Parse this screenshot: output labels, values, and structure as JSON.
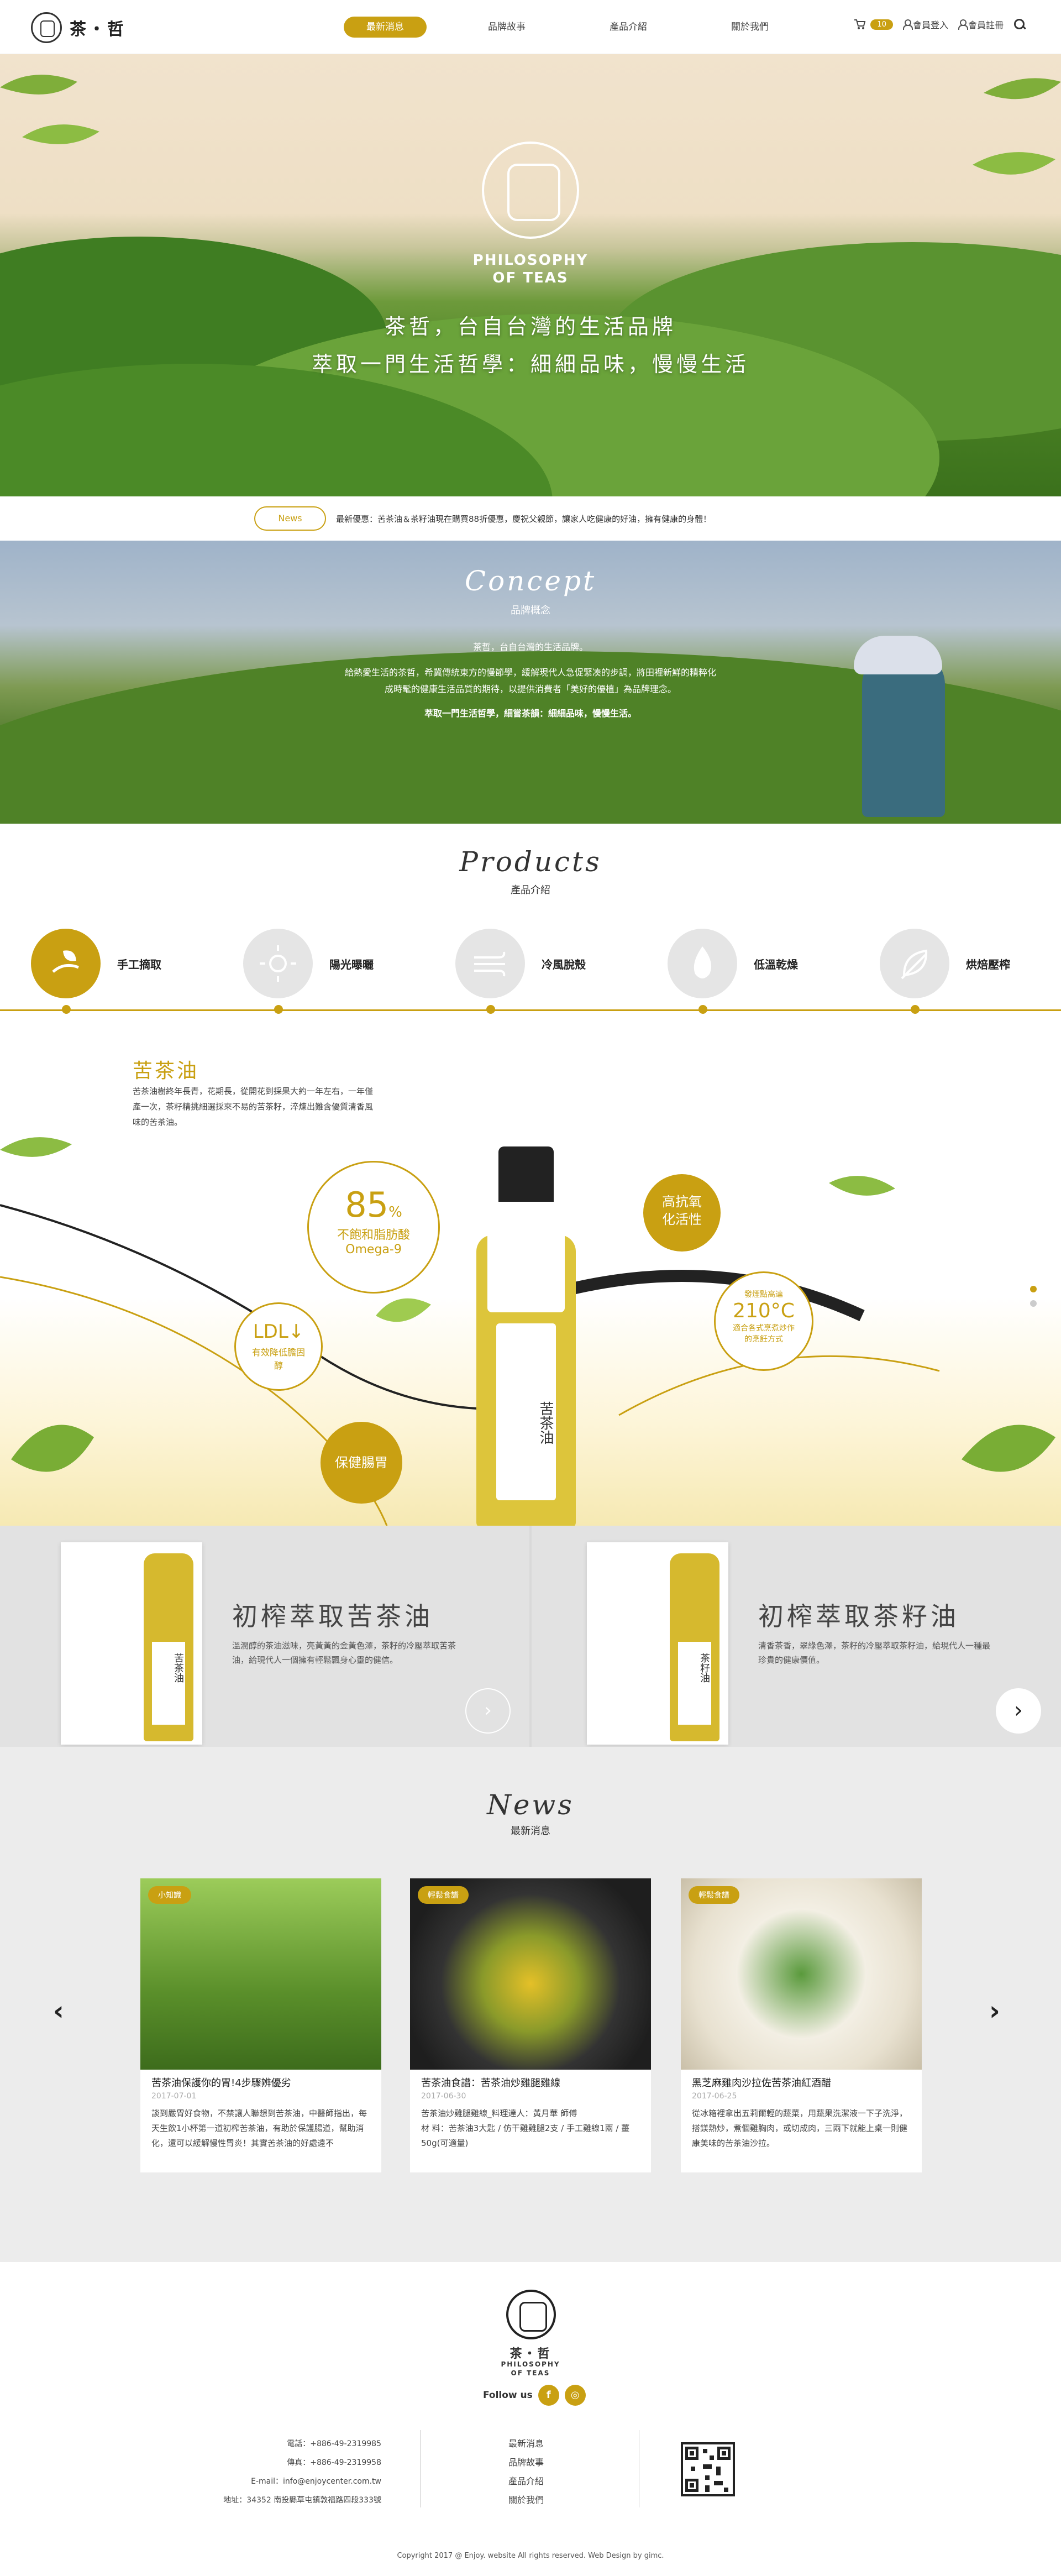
{
  "header": {
    "brand": "茶・哲",
    "nav": [
      {
        "label": "最新消息",
        "active": true
      },
      {
        "label": "品牌故事",
        "active": false
      },
      {
        "label": "產品介紹",
        "active": false
      },
      {
        "label": "關於我們",
        "active": false
      }
    ],
    "cart_count": "10",
    "login": "會員登入",
    "register": "會員註冊",
    "icons": [
      "cart-icon",
      "user-icon",
      "add-user-icon",
      "search-icon"
    ]
  },
  "hero": {
    "logo_en": "PHILOSOPHY",
    "logo_en2": "OF TEAS",
    "line1": "茶哲，台自台灣的生活品牌",
    "line2": "萃取一門生活哲學：細細品味，慢慢生活"
  },
  "newsbar": {
    "pill": "News",
    "text": "最新優惠：苦茶油＆茶籽油現在購買88折優惠，慶祝父親節，讓家人吃健康的好油，擁有健康的身體！"
  },
  "concept": {
    "title": "Concept",
    "subtitle": "品牌概念",
    "p1": "茶哲，台自台灣的生活品牌。",
    "p2": "給熱愛生活的茶哲，希冀傳統東方的慢節學，緩解現代人急促緊凑的步調，將田裡新鮮的精粹化",
    "p3": "成時髦的健康生活品質的期待，以提供消費者「美好的優植」為品牌理念。",
    "p4": "萃取一門生活哲學，細嘗茶韻：細細品味，慢慢生活。"
  },
  "products": {
    "title": "Products",
    "subtitle": "產品介紹",
    "steps": [
      {
        "label": "手工摘取",
        "icon": "hand-leaf-icon",
        "active": true
      },
      {
        "label": "陽光曝曬",
        "icon": "sun-icon",
        "active": false
      },
      {
        "label": "冷風脫殼",
        "icon": "wind-icon",
        "active": false
      },
      {
        "label": "低溫乾燥",
        "icon": "flame-icon",
        "active": false
      },
      {
        "label": "烘焙壓榨",
        "icon": "leaf-slash-icon",
        "active": false
      }
    ],
    "oil_title": "苦茶油",
    "oil_desc": "苦茶油樹終年長青，花期長，從開花到採果大約一年左右，一年僅產一次，茶籽精挑細選採來不易的苦茶籽，淬煉出難含優質清香風味的苦茶油。",
    "bottle_label": "苦茶油",
    "bubbles": {
      "omega_value": "85",
      "omega_unit": "%",
      "omega_line1": "不飽和脂肪酸",
      "omega_line2": "Omega-9",
      "antiox": "高抗氧化活性",
      "ldl": "LDL↓",
      "ldl_sub": "有效降低膽固醇",
      "smoke_top": "發煙點高達",
      "smoke_val": "210°C",
      "smoke_sub": "適合各式烹煮炒作的烹飪方式",
      "stomach": "保健腸胃"
    }
  },
  "cards": [
    {
      "title": "初榨萃取苦茶油",
      "desc": "溫潤醇的茶油滋味，亮黃黃的金黃色澤，茶籽的冷壓萃取苦茶油，給現代人一個擁有輕鬆飄身心靈的健信。",
      "bottle": "苦茶油"
    },
    {
      "title": "初榨萃取茶籽油",
      "desc": "清香茶香，翠綠色澤，茶籽的冷壓萃取茶籽油，給現代人一種最珍貴的健康價值。",
      "bottle": "茶籽油"
    }
  ],
  "news": {
    "title": "News",
    "subtitle": "最新消息",
    "items": [
      {
        "tag": "小知識",
        "title": "苦茶油保護你的胃!4步驟辨優劣",
        "date": "2017-07-01",
        "text": "談到嚴胃好食物，不禁讓人聯想到苦茶油，中醫師指出，每天生飲1小杯第一道初榨苦茶油，有助於保護腸道，幫助消化，還可以緩解慢性胃炎！其實苦茶油的好處遠不"
      },
      {
        "tag": "輕鬆食譜",
        "title": "苦茶油食譜：苦茶油炒雞腿雞線",
        "date": "2017-06-30",
        "text": "苦茶油炒雞腿雞線_料理達人：黃月華 師傅\n材 料：苦茶油3大匙 / 仿干雞雞腿2支 / 手工雞線1兩 / 薑50g(可適量)"
      },
      {
        "tag": "輕鬆食譜",
        "title": "黑芝麻雞肉沙拉佐苦茶油紅酒醋",
        "date": "2017-06-25",
        "text": "從冰箱裡拿出五莉爾輕的蔬菜，用蔬果洗潔液一下子洗淨，搭鎂熱炒，煮個雞胸肉，或切成肉，三兩下就能上桌一則健康美味的苦茶油沙拉。"
      }
    ]
  },
  "footer": {
    "brand": "茶・哲",
    "en1": "PHILOSOPHY",
    "en2": "OF TEAS",
    "follow": "Follow us",
    "social": [
      "f",
      "◎"
    ],
    "contact": [
      "電話：+886-49-2319985",
      "傳真：+886-49-2319958",
      "E-mail：info@enjoycenter.com.tw",
      "地址：34352 南投縣草屯鎮敦福路四段333號"
    ],
    "links": [
      "最新消息",
      "品牌故事",
      "產品介紹",
      "關於我們"
    ],
    "copyright": "Copyright 2017 @ Enjoy. website All rights reserved. Web Design by gimc."
  },
  "colors": {
    "accent": "#c9a012",
    "grey_bg": "#ececec"
  }
}
